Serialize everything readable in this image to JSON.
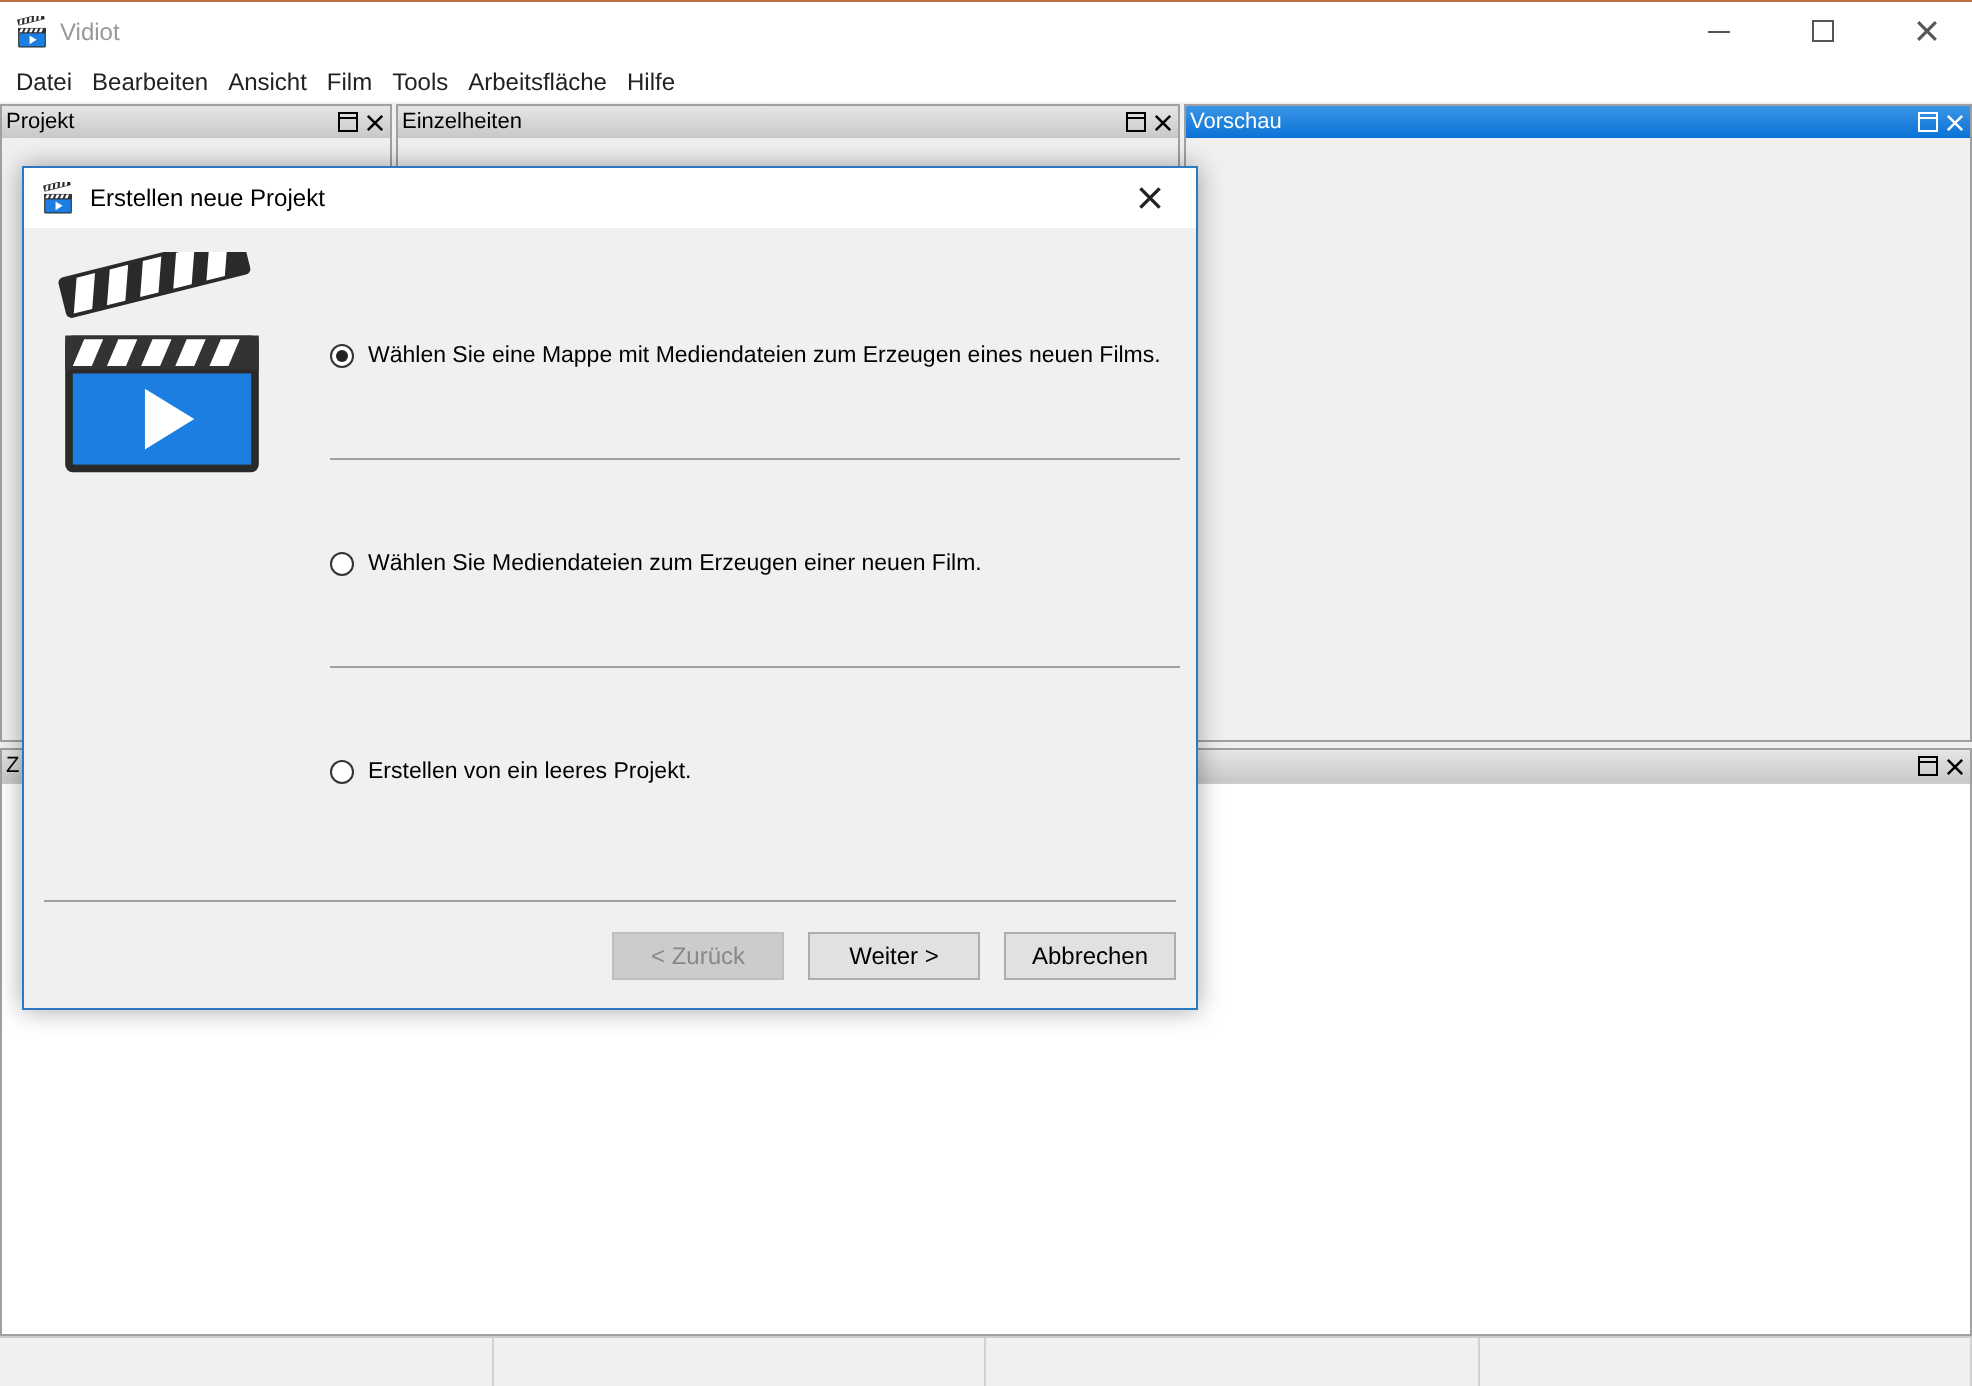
{
  "window": {
    "title": "Vidiot"
  },
  "menu": [
    "Datei",
    "Bearbeiten",
    "Ansicht",
    "Film",
    "Tools",
    "Arbeitsfläche",
    "Hilfe"
  ],
  "panels": [
    {
      "title": "Projekt",
      "selected": false
    },
    {
      "title": "Einzelheiten",
      "selected": false
    },
    {
      "title": "Vorschau",
      "selected": true
    }
  ],
  "bottom_panel": {
    "title": "Z"
  },
  "dialog": {
    "title": "Erstellen neue Projekt",
    "options": [
      {
        "label": "Wählen Sie eine Mappe mit Mediendateien zum Erzeugen eines neuen Films.",
        "selected": true
      },
      {
        "label": "Wählen Sie Mediendateien zum Erzeugen einer neuen Film.",
        "selected": false
      },
      {
        "label": "Erstellen von ein leeres Projekt.",
        "selected": false
      }
    ],
    "buttons": [
      {
        "label": "< Zurück",
        "disabled": true
      },
      {
        "label": "Weiter >",
        "disabled": false
      },
      {
        "label": "Abbrechen",
        "disabled": false
      }
    ]
  }
}
